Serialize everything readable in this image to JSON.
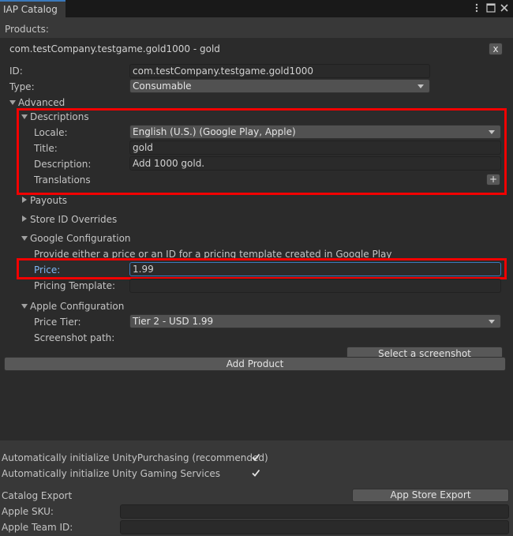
{
  "window": {
    "tab_title": "IAP Catalog"
  },
  "products_label": "Products:",
  "product": {
    "header": "com.testCompany.testgame.gold1000 - gold",
    "close_label": "x",
    "id_label": "ID:",
    "id_value": "com.testCompany.testgame.gold1000",
    "type_label": "Type:",
    "type_value": "Consumable",
    "advanced_label": "Advanced",
    "descriptions": {
      "label": "Descriptions",
      "locale_label": "Locale:",
      "locale_value": "English (U.S.) (Google Play, Apple)",
      "title_label": "Title:",
      "title_value": "gold",
      "description_label": "Description:",
      "description_value": "Add 1000 gold.",
      "translations_label": "Translations",
      "add_label": "+"
    },
    "payouts_label": "Payouts",
    "store_id_overrides_label": "Store ID Overrides",
    "google": {
      "label": "Google Configuration",
      "hint": "Provide either a price or an ID for a pricing template created in Google Play",
      "price_label": "Price:",
      "price_value": "1.99",
      "pricing_template_label": "Pricing Template:",
      "pricing_template_value": ""
    },
    "apple": {
      "label": "Apple Configuration",
      "price_tier_label": "Price Tier:",
      "price_tier_value": "Tier 2 - USD 1.99",
      "screenshot_label": "Screenshot path:",
      "select_screenshot_label": "Select a screenshot"
    }
  },
  "add_product_label": "Add Product",
  "settings": {
    "auto_init_purchasing_label": "Automatically initialize UnityPurchasing (recommended)",
    "auto_init_purchasing_checked": true,
    "auto_init_ugs_label": "Automatically initialize Unity Gaming Services",
    "auto_init_ugs_checked": true
  },
  "export": {
    "catalog_export_label": "Catalog Export",
    "app_store_export_label": "App Store Export",
    "apple_sku_label": "Apple SKU:",
    "apple_sku_value": "",
    "apple_team_id_label": "Apple Team ID:",
    "apple_team_id_value": ""
  },
  "colors": {
    "highlight": "#f20000",
    "focus": "#3a79bb",
    "label_active": "#7fb6f2"
  }
}
